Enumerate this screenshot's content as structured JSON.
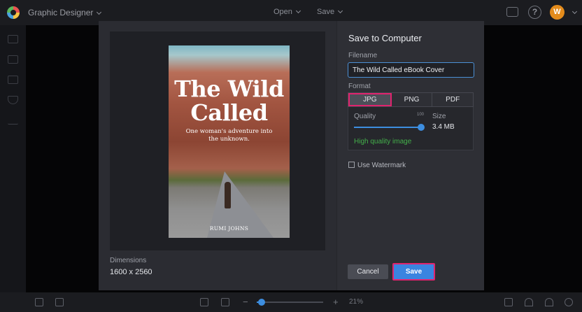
{
  "topbar": {
    "app_title": "Graphic Designer",
    "open_label": "Open",
    "save_label": "Save",
    "user_initial": "W"
  },
  "bottombar": {
    "zoom_text": "21%",
    "zoom_minus": "−",
    "zoom_plus": "+",
    "zoom_level": 0.21
  },
  "dialog": {
    "title": "Save to Computer",
    "filename_label": "Filename",
    "filename_value": "The Wild Called eBook Cover",
    "format_label": "Format",
    "formats": [
      "JPG",
      "PNG",
      "PDF"
    ],
    "selected_format": "JPG",
    "quality_label": "Quality",
    "quality_max": "100",
    "quality_value": 100,
    "size_label": "Size",
    "size_value": "3.4 MB",
    "quality_note": "High quality image",
    "watermark_label": "Use Watermark",
    "watermark_checked": false,
    "cancel_label": "Cancel",
    "save_label": "Save",
    "dimensions_label": "Dimensions",
    "dimensions_value": "1600 x 2560"
  },
  "cover": {
    "title_line1": "The Wild",
    "title_line2": "Called",
    "subtitle": "One woman's adventure into the unknown.",
    "author": "RUMI JOHNS"
  },
  "colors": {
    "accent": "#3a84e0",
    "highlight": "#e0236e",
    "success": "#43b04a"
  }
}
